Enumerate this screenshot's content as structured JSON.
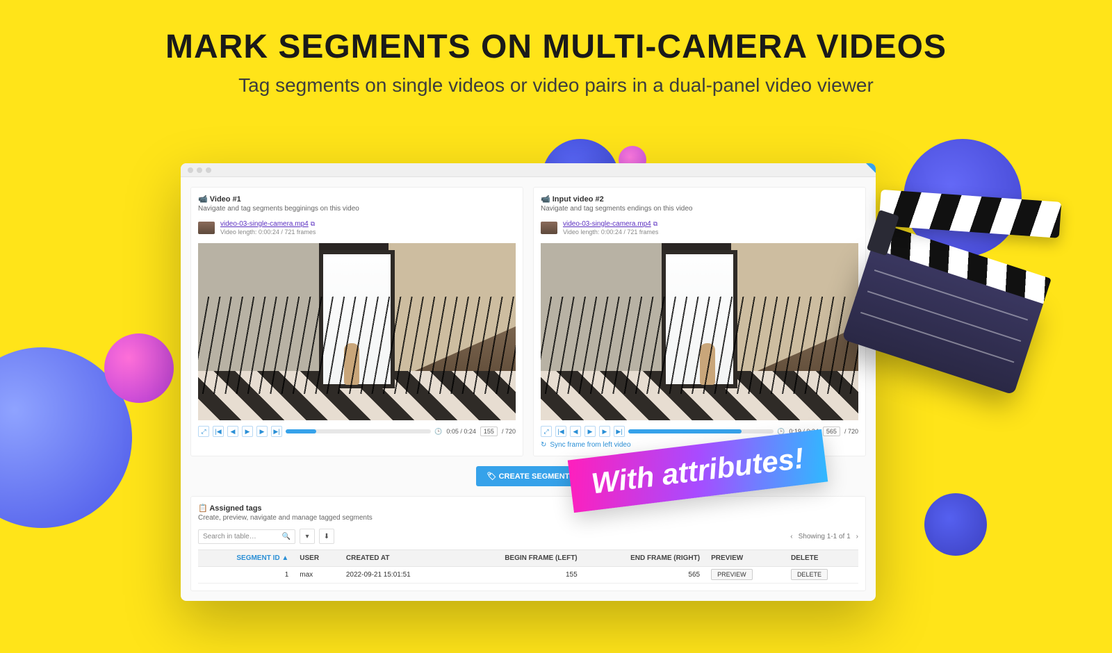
{
  "hero": {
    "headline": "MARK SEGMENTS ON MULTI-CAMERA VIDEOS",
    "subhead": "Tag segments on single videos or video pairs in a dual-panel video viewer"
  },
  "badge": {
    "text": "With attributes!"
  },
  "app": {
    "left": {
      "title": "📹 Video #1",
      "subtitle": "Navigate and tag segments begginings on this video",
      "filename": "video-03-single-camera.mp4",
      "length_line": "Video length: 0:00:24 / 721 frames",
      "time": "0:05 / 0:24",
      "frame": "155",
      "total_frames": "720",
      "progress_pct": 21
    },
    "right": {
      "title": "📹 Input video #2",
      "subtitle": "Navigate and tag segments endings on this video",
      "filename": "video-03-single-camera.mp4",
      "length_line": "Video length: 0:00:24 / 721 frames",
      "time": "0:19 / 0:24",
      "frame": "565",
      "total_frames": "720",
      "progress_pct": 78,
      "sync_label": "Sync frame from left video"
    },
    "create_segment": "CREATE SEGMENT",
    "tags": {
      "title": "📋 Assigned tags",
      "subtitle": "Create, preview, navigate and manage tagged segments",
      "search_placeholder": "Search in table…",
      "pager": "Showing 1-1 of 1",
      "columns": {
        "segment_id": "SEGMENT ID ▲",
        "user": "USER",
        "created_at": "CREATED AT",
        "begin_frame": "BEGIN FRAME (LEFT)",
        "end_frame": "END FRAME (RIGHT)",
        "preview": "PREVIEW",
        "delete": "DELETE"
      },
      "rows": [
        {
          "id": "1",
          "user": "max",
          "created_at": "2022-09-21 15:01:51",
          "begin": "155",
          "end": "565",
          "preview_btn": "PREVIEW",
          "delete_btn": "DELETE"
        }
      ]
    }
  }
}
